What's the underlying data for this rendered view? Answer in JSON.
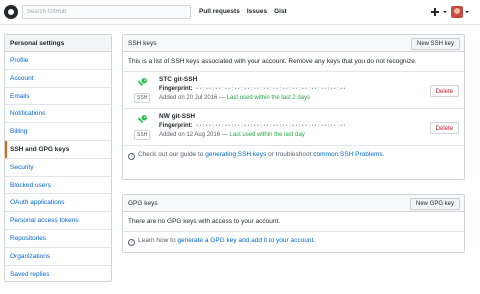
{
  "header": {
    "search_placeholder": "Search GitHub",
    "nav": [
      "Pull requests",
      "Issues",
      "Gist"
    ]
  },
  "sidebar": {
    "title": "Personal settings",
    "items": [
      {
        "label": "Profile",
        "active": false
      },
      {
        "label": "Account",
        "active": false
      },
      {
        "label": "Emails",
        "active": false
      },
      {
        "label": "Notifications",
        "active": false
      },
      {
        "label": "Billing",
        "active": false
      },
      {
        "label": "SSH and GPG keys",
        "active": true
      },
      {
        "label": "Security",
        "active": false
      },
      {
        "label": "Blocked users",
        "active": false
      },
      {
        "label": "OAuth applications",
        "active": false
      },
      {
        "label": "Personal access tokens",
        "active": false
      },
      {
        "label": "Repositories",
        "active": false
      },
      {
        "label": "Organizations",
        "active": false
      },
      {
        "label": "Saved replies",
        "active": false
      }
    ]
  },
  "ssh": {
    "title": "SSH keys",
    "new_button": "New SSH key",
    "intro": "This is a list of SSH keys associated with your account. Remove any keys that you do not recognize.",
    "keys": [
      {
        "title": "STC git-SSH",
        "badge": "SSH",
        "fingerprint_label": "Fingerprint:",
        "fingerprint": "••:••:••:••:••:••:••:••:••:••:••:••:••:••:••:••",
        "added": "Added on 20 Jul 2016 — ",
        "used": "Last used within the last 2 days",
        "delete": "Delete"
      },
      {
        "title": "NW git-SSH",
        "badge": "SSH",
        "fingerprint_label": "Fingerprint:",
        "fingerprint": "••:••:••:••:••:••:••:••:••:••:••:••:••:••:••:••",
        "added": "Added on 12 Aug 2016 — ",
        "used": "Last used within the last day",
        "delete": "Delete"
      }
    ],
    "help_prefix": "Check out our guide to ",
    "help_link1": "generating SSH keys",
    "help_middle": " or troubleshoot ",
    "help_link2": "common SSH Problems",
    "help_suffix": "."
  },
  "gpg": {
    "title": "GPG keys",
    "new_button": "New GPG key",
    "empty": "There are no GPG keys with access to your account.",
    "help_prefix": "Learn how to ",
    "help_link1": "generate a GPG key and add it to your account",
    "help_suffix": "."
  },
  "colors": {
    "link": "#0366d6",
    "green": "#28a745",
    "danger": "#cb2431",
    "active_bar": "#e36209"
  }
}
